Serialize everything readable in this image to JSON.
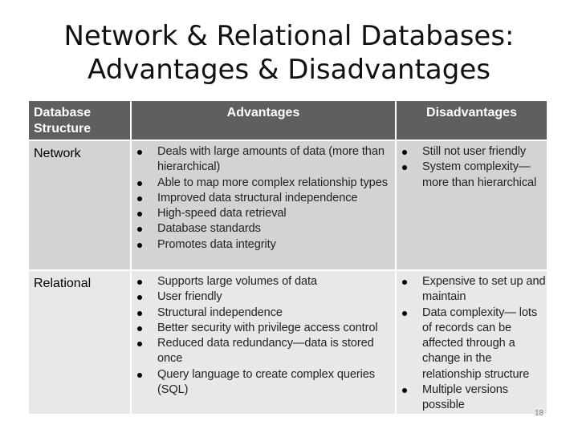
{
  "title": {
    "line1": "Network & Relational Databases:",
    "line2": "Advantages & Disadvantages"
  },
  "table": {
    "headers": [
      "Database Structure",
      "Advantages",
      "Disadvantages"
    ],
    "rows": [
      {
        "structure": "Network",
        "advantages": [
          "Deals with large amounts of data (more than hierarchical)",
          "Able to map more complex relationship types",
          "Improved data structural independence",
          "High-speed data retrieval",
          "Database standards",
          "Promotes data integrity"
        ],
        "disadvantages": [
          "Still not user friendly",
          "System complexity— more than hierarchical"
        ]
      },
      {
        "structure": "Relational",
        "advantages": [
          "Supports large volumes of data",
          "User friendly",
          "Structural independence",
          "Better security with privilege access control",
          "Reduced data redundancy—data is stored once",
          "Query language to create complex queries (SQL)"
        ],
        "disadvantages": [
          "Expensive to set up and maintain",
          "Data complexity— lots of records can be affected through a change in the relationship structure",
          "Multiple versions possible"
        ]
      }
    ]
  },
  "page_number": "18",
  "colors": {
    "header_bg": "#5f5f5f",
    "row_network_bg": "#d3d3d3",
    "row_relational_bg": "#e8e8e8"
  }
}
